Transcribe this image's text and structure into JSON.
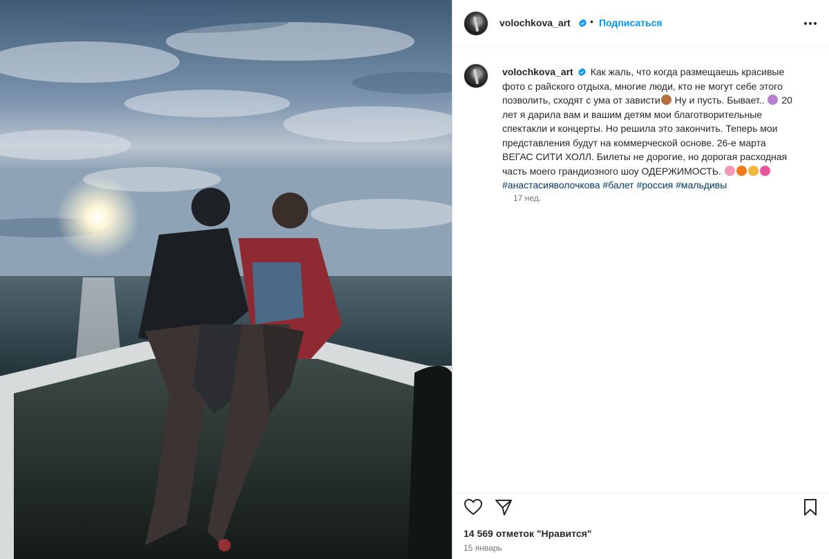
{
  "post": {
    "username": "volochkova_art",
    "separator": "•",
    "follow_label": "Подписаться",
    "more_icon": "more-horizontal-icon",
    "caption_lines": [
      "Как жаль, что когда размещаешь красивые",
      "фото с райского отдыха, многие люди, кто не могут себе этого",
      "позволить, сходят с ума от зависти",
      "Ну и пусть. Бывает..",
      "20",
      "лет я дарила вам и вашим детям мои благотворительные",
      "спектакли и концерты. Но решила это закончить. Теперь мои",
      "представления будут на коммерческой основе. 26-е марта",
      "ВЕГАС СИТИ ХОЛЛ. Билеты не дорогие, но дорогая расходная",
      "часть моего грандиозного шоу ОДЕРЖИМОСТЬ."
    ],
    "hashtags": [
      "#анастасияволочкова",
      "#балет",
      "#россия",
      "#мальдивы"
    ],
    "caption_age": "17 нед.",
    "likes_text": "14 569 отметок \"Нравится\"",
    "date_text": "15 январь",
    "icons": {
      "like": "heart-icon",
      "share": "share-icon",
      "save": "bookmark-icon",
      "verified": "verified-badge-icon"
    },
    "colors": {
      "link": "#0095f6",
      "hashtag": "#00376b",
      "verified": "#0095f6",
      "muted": "#737373"
    }
  }
}
